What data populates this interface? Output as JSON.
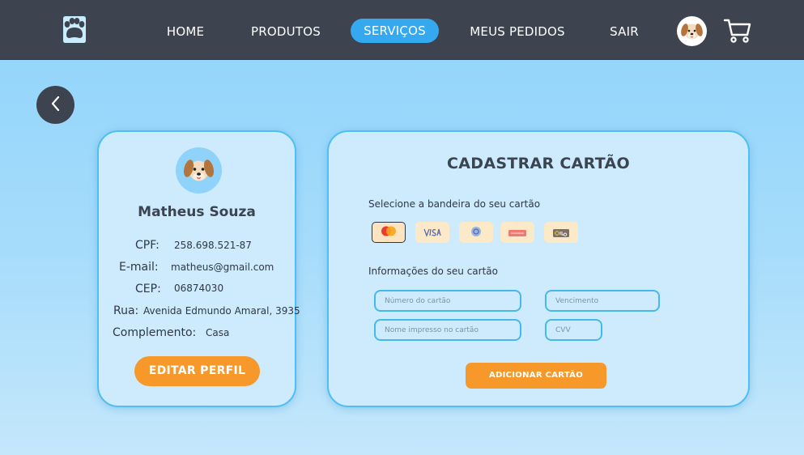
{
  "nav": {
    "logo_icon": "paw-icon",
    "links": [
      "HOME",
      "PRODUTOS",
      "SERVIÇOS",
      "MEUS PEDIDOS",
      "SAIR"
    ],
    "active": "SERVIÇOS",
    "avatar_icon": "dog-avatar-icon",
    "cart_icon": "cart-icon"
  },
  "back_icon": "chevron-left-icon",
  "profile": {
    "name": "Matheus Souza",
    "fields": [
      {
        "label": "CPF:",
        "value": "258.698.521-87"
      },
      {
        "label": "E-mail:",
        "value": "matheus@gmail.com"
      },
      {
        "label": "CEP:",
        "value": "06874030"
      },
      {
        "label": "Rua:",
        "value": "Avenida Edmundo Amaral, 3935"
      },
      {
        "label": "Complemento:",
        "value": "Casa"
      }
    ],
    "edit_button": "EDITAR PERFIL"
  },
  "card_form": {
    "title": "CADASTRAR CARTÃO",
    "brand_prompt": "Selecione a bandeira do seu cartão",
    "brands": [
      "mastercard",
      "VISA",
      "diners",
      "hipercard",
      "elo"
    ],
    "selected_brand": "mastercard",
    "info_prompt": "Informações do seu cartão",
    "placeholders": {
      "number": "Número do cartão",
      "expiry": "Vencimento",
      "name": "Nome impresso no cartão",
      "cvv": "CVV"
    },
    "submit": "ADICIONAR CARTÃO"
  },
  "colors": {
    "navbar": "#3d444f",
    "active_tab": "#35a9ef",
    "accent": "#f6992a",
    "card_border": "#4fbef2",
    "card_bg": "#cdebfc"
  }
}
